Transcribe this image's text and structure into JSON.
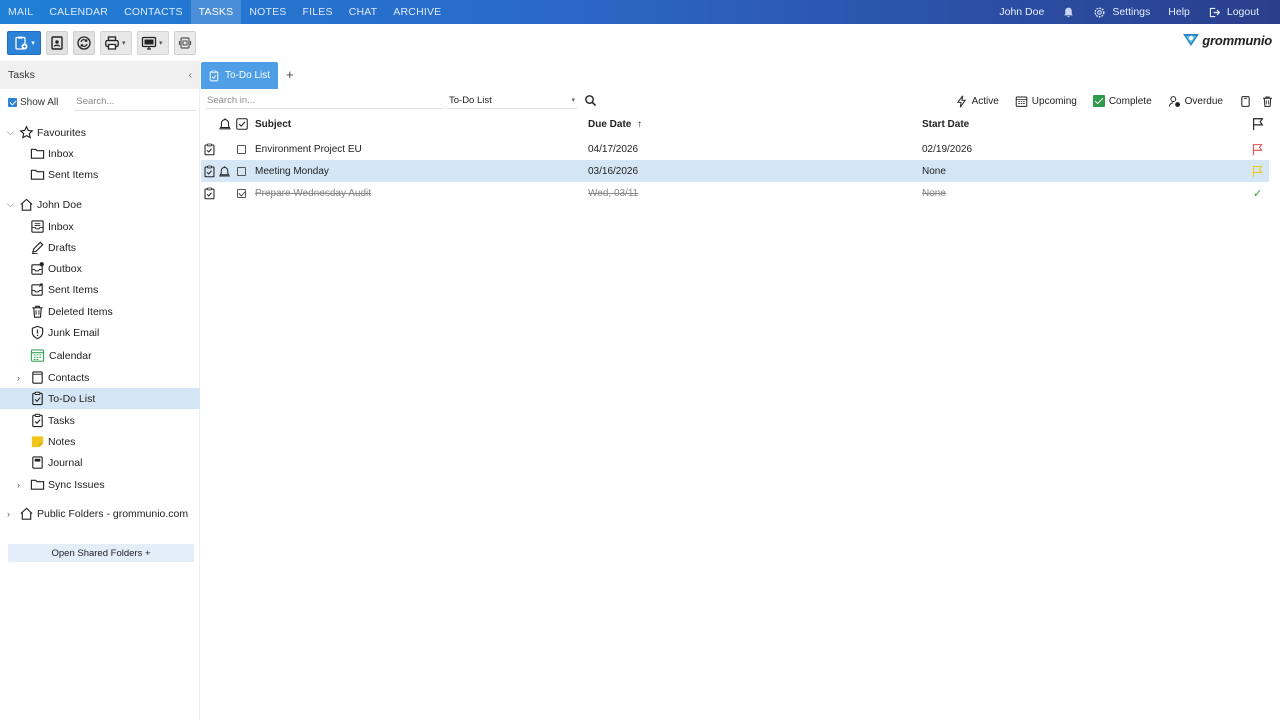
{
  "topnav": {
    "items": [
      "MAIL",
      "CALENDAR",
      "CONTACTS",
      "TASKS",
      "NOTES",
      "FILES",
      "CHAT",
      "ARCHIVE"
    ],
    "active_index": 3,
    "user_name": "John Doe",
    "settings_label": "Settings",
    "help_label": "Help",
    "logout_label": "Logout"
  },
  "toolbar": {
    "logo_text": "grommunio"
  },
  "sidebar": {
    "header": "Tasks",
    "show_all_label": "Show All",
    "search_placeholder": "Search...",
    "favourites_label": "Favourites",
    "favourites": [
      "Inbox",
      "Sent Items"
    ],
    "account_label": "John Doe",
    "folders": [
      "Inbox",
      "Drafts",
      "Outbox",
      "Sent Items",
      "Deleted Items",
      "Junk Email",
      "Calendar",
      "Contacts",
      "To-Do List",
      "Tasks",
      "Notes",
      "Journal",
      "Sync Issues"
    ],
    "public_folders_label": "Public Folders - grommunio.com",
    "shared_button": "Open Shared Folders +"
  },
  "main": {
    "tab_label": "To-Do List",
    "search_placeholder": "Search in...",
    "folder_select": "To-Do List",
    "filters": {
      "active": "Active",
      "upcoming": "Upcoming",
      "complete": "Complete",
      "overdue": "Overdue"
    },
    "columns": {
      "subject": "Subject",
      "due_date": "Due Date",
      "start_date": "Start Date"
    },
    "rows": [
      {
        "subject": "Environment Project EU",
        "due": "04/17/2026",
        "start": "02/19/2026",
        "flag": "red"
      },
      {
        "subject": "Meeting Monday",
        "due": "03/16/2026",
        "start": "None",
        "flag": "yellow"
      },
      {
        "subject": "Prepare Wednesday Audit",
        "due": "Wed, 03/11",
        "start": "None",
        "flag": "complete"
      }
    ]
  },
  "colors": {
    "accent": "#2b82d6",
    "selection": "#d5e6f6",
    "flag_red": "#e0514e",
    "flag_yellow": "#f2c51b",
    "complete_green": "#2e9a4a"
  }
}
